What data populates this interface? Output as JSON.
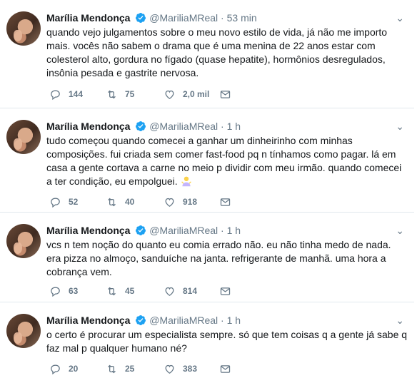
{
  "tweets": [
    {
      "name": "Marília Mendonça",
      "handle": "@MariliaMReal",
      "dot": "·",
      "time": "53 min",
      "text": "quando vejo julgamentos sobre o meu novo estilo de vida, já não me importo mais. vocês não sabem o drama que é uma menina de 22 anos estar com colesterol alto, gordura no fígado (quase hepatite), hormônios desregulados, insônia pesada e gastrite nervosa.",
      "replies": "144",
      "retweets": "75",
      "likes": "2,0 mil"
    },
    {
      "name": "Marília Mendonça",
      "handle": "@MariliaMReal",
      "dot": "·",
      "time": "1 h",
      "text": "tudo começou quando comecei a ganhar um dinheirinho com minhas composições. fui criada sem comer fast-food pq n tínhamos como pagar. lá em casa a gente cortava a carne no meio p dividir com meu irmão. quando comecei a ter condição, eu empolguei.",
      "emoji": "person-shrugging-emoji",
      "replies": "52",
      "retweets": "40",
      "likes": "918"
    },
    {
      "name": "Marília Mendonça",
      "handle": "@MariliaMReal",
      "dot": "·",
      "time": "1 h",
      "text": "vcs n tem noção do quanto eu comia errado não. eu não tinha medo de nada. era pizza no almoço, sanduíche na janta. refrigerante de manhã. uma hora a cobrança vem.",
      "replies": "63",
      "retweets": "45",
      "likes": "814"
    },
    {
      "name": "Marília Mendonça",
      "handle": "@MariliaMReal",
      "dot": "·",
      "time": "1 h",
      "text": "o certo é procurar um especialista sempre. só que tem coisas q a gente já sabe q faz mal p qualquer humano né?",
      "replies": "20",
      "retweets": "25",
      "likes": "383"
    }
  ],
  "colors": {
    "muted": "#657786",
    "verified": "#1da1f2",
    "border": "#e1e8ed"
  },
  "icons": [
    "verified-badge-icon",
    "chevron-down-icon",
    "reply-icon",
    "retweet-icon",
    "like-icon",
    "direct-message-icon"
  ]
}
